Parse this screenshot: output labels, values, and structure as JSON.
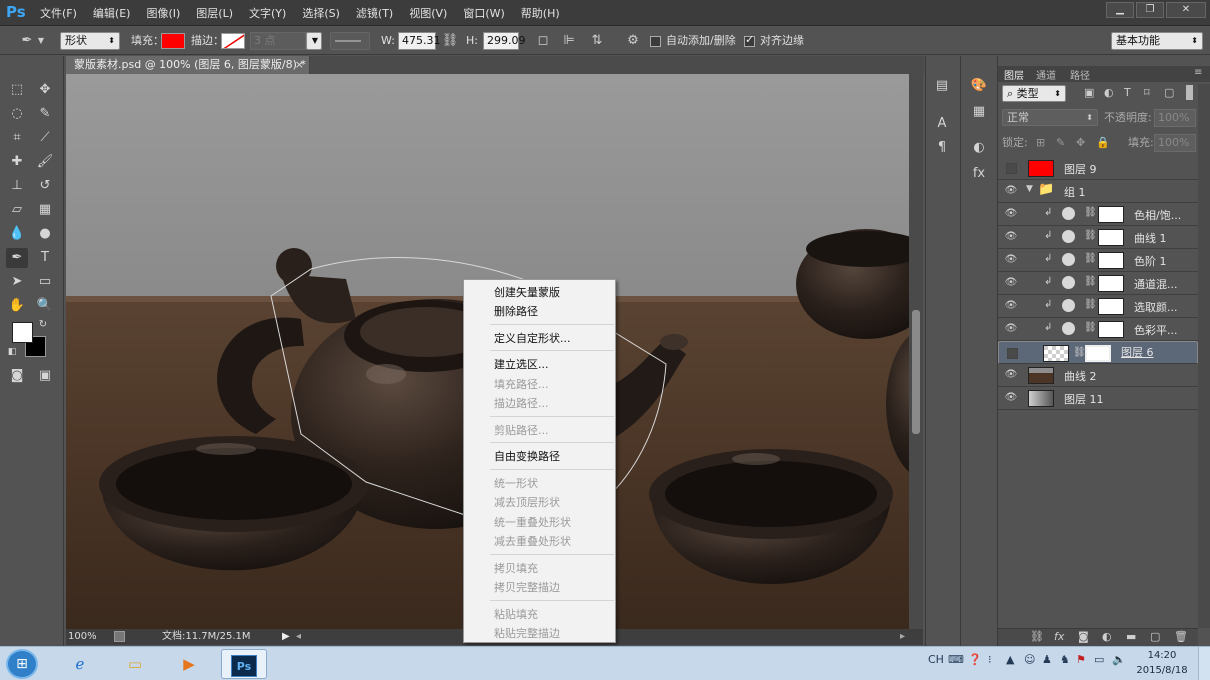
{
  "app": {
    "logo": "Ps"
  },
  "menubar": {
    "items": [
      "文件(F)",
      "编辑(E)",
      "图像(I)",
      "图层(L)",
      "文字(Y)",
      "选择(S)",
      "滤镜(T)",
      "视图(V)",
      "窗口(W)",
      "帮助(H)"
    ],
    "win_min": "▁",
    "win_restore": "❐",
    "win_close": "✕"
  },
  "options": {
    "mode": "形状",
    "fill_label": "填充：",
    "fill_color": "#ff0000",
    "stroke_label": "描边：",
    "stroke_width": "3 点",
    "w_label": "W:",
    "w_value": "475.31",
    "h_label": "H:",
    "h_value": "299.09",
    "auto_add_label": "自动添加/删除",
    "align_edges_label": "对齐边缘",
    "workspace": "基本功能"
  },
  "document": {
    "tab_title": "蒙版素材.psd @ 100% (图层 6, 图层蒙版/8) *",
    "zoom": "100%",
    "doc_size": "文档:11.7M/25.1M"
  },
  "context_menu": {
    "items": [
      {
        "label": "创建矢量蒙版",
        "enabled": true
      },
      {
        "label": "删除路径",
        "enabled": true
      },
      {
        "label": "定义自定形状...",
        "enabled": true
      },
      {
        "label": "建立选区...",
        "enabled": true
      },
      {
        "label": "填充路径...",
        "enabled": false
      },
      {
        "label": "描边路径...",
        "enabled": false
      },
      {
        "label": "剪贴路径...",
        "enabled": false
      },
      {
        "label": "自由变换路径",
        "enabled": true
      },
      {
        "label": "统一形状",
        "enabled": false
      },
      {
        "label": "减去顶层形状",
        "enabled": false
      },
      {
        "label": "统一重叠处形状",
        "enabled": false
      },
      {
        "label": "减去重叠处形状",
        "enabled": false
      },
      {
        "label": "拷贝填充",
        "enabled": false
      },
      {
        "label": "拷贝完整描边",
        "enabled": false
      },
      {
        "label": "粘贴填充",
        "enabled": false
      },
      {
        "label": "粘贴完整描边",
        "enabled": false
      }
    ]
  },
  "layers_panel": {
    "tabs": [
      "图层",
      "通道",
      "路径"
    ],
    "filter_kind": "类型",
    "blend_mode": "正常",
    "opacity_label": "不透明度:",
    "opacity_value": "100%",
    "lock_label": "锁定:",
    "fill_label": "填充:",
    "fill_value": "100%",
    "layers": [
      {
        "name": "图层 9",
        "visible": false,
        "thumb": "red"
      },
      {
        "name": "组 1",
        "visible": true,
        "thumb": "group"
      },
      {
        "name": "色相/饱...",
        "visible": true,
        "thumb": "adjust"
      },
      {
        "name": "曲线 1",
        "visible": true,
        "thumb": "adjust"
      },
      {
        "name": "色阶 1",
        "visible": true,
        "thumb": "adjust"
      },
      {
        "name": "通道混...",
        "visible": true,
        "thumb": "adjust"
      },
      {
        "name": "选取颜...",
        "visible": true,
        "thumb": "adjust"
      },
      {
        "name": "色彩平...",
        "visible": true,
        "thumb": "adjust"
      },
      {
        "name": "图层 6",
        "visible": false,
        "thumb": "masked",
        "selected": true
      },
      {
        "name": "曲线 2",
        "visible": true,
        "thumb": "photo"
      },
      {
        "name": "图层 11",
        "visible": true,
        "thumb": "gradient"
      }
    ]
  },
  "taskbar": {
    "input_method": "CH",
    "time": "14:20",
    "date": "2015/8/18"
  }
}
